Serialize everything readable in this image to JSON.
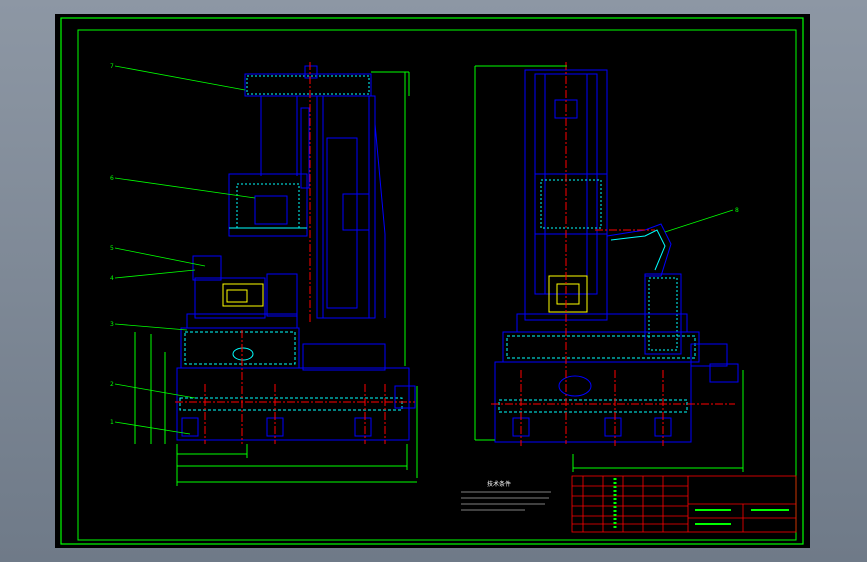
{
  "drawing": {
    "part_labels_left": [
      "7",
      "6",
      "5",
      "4",
      "3",
      "2",
      "1"
    ],
    "part_labels_right": [
      "8"
    ],
    "notes_title": "技术条件",
    "colors": {
      "background": "#000000",
      "frame": "#00ff00",
      "outline": "#0000ff",
      "centerline": "#ff0000",
      "dimension": "#00ff00",
      "leader": "#00ff00",
      "hatch": "#00ffff",
      "highlight": "#ffff00",
      "note_text": "#ffffff"
    }
  }
}
